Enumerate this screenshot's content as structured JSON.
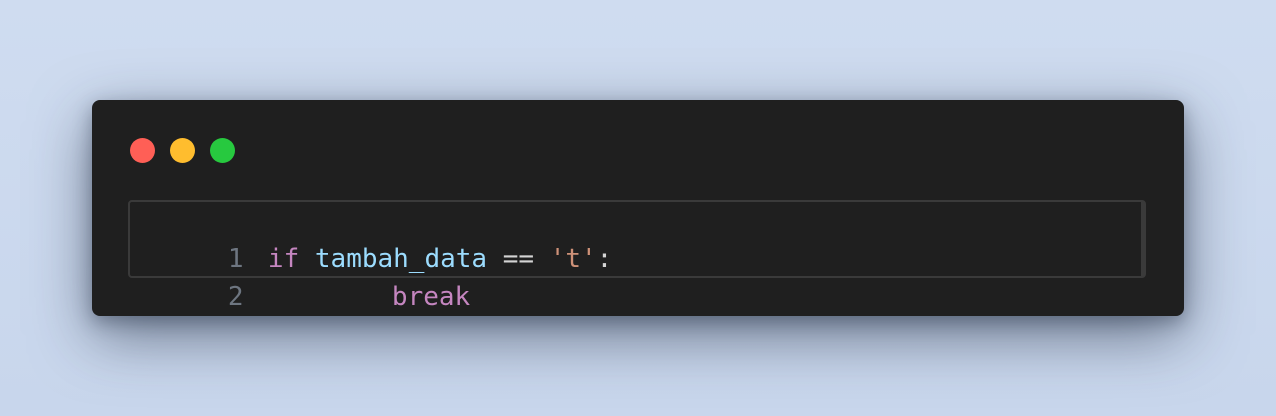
{
  "window": {
    "controls": [
      "close",
      "minimize",
      "maximize"
    ],
    "colors": {
      "close": "#ff5f56",
      "minimize": "#ffbd2e",
      "maximize": "#27c93f",
      "background": "#1f1f1f"
    }
  },
  "code": {
    "lines": [
      {
        "number": "1",
        "tokens": {
          "kw": "if",
          "var": "tambah_data",
          "op": "==",
          "str": "'t'",
          "punct": ":"
        }
      },
      {
        "number": "2",
        "tokens": {
          "kw": "break"
        }
      }
    ],
    "syntax_colors": {
      "keyword": "#c586c0",
      "variable": "#9cdcfe",
      "operator": "#d4d4d4",
      "string": "#ce9178",
      "line_number": "#6e7681"
    }
  }
}
